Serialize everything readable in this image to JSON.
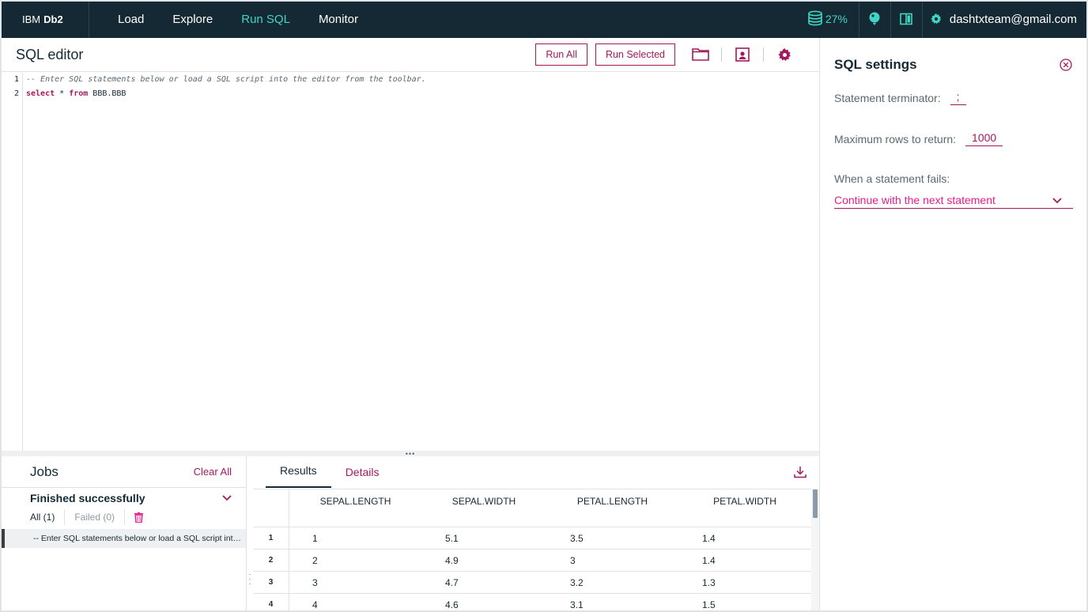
{
  "nav": {
    "brand_prefix": "IBM",
    "brand_bold": "Db2",
    "items": [
      {
        "label": "Load",
        "active": false
      },
      {
        "label": "Explore",
        "active": false
      },
      {
        "label": "Run SQL",
        "active": true
      },
      {
        "label": "Monitor",
        "active": false
      }
    ],
    "usage": "27%",
    "user": "dashtxteam@gmail.com",
    "icons": [
      "database-icon",
      "help-balloon-icon",
      "book-icon",
      "gear-icon"
    ]
  },
  "editor": {
    "title": "SQL editor",
    "run_all": "Run All",
    "run_selected": "Run Selected",
    "line_numbers": [
      "1",
      "2"
    ],
    "line1_comment": "-- Enter SQL statements below or load a SQL script into the editor from the toolbar.",
    "line2_kw1": "select",
    "line2_star": " * ",
    "line2_kw2": "from",
    "line2_table": " BBB.BBB",
    "tool_icons": [
      "folder-icon",
      "save-script-icon",
      "gear-icon"
    ]
  },
  "splitter": "•••",
  "jobs": {
    "title": "Jobs",
    "clear_all": "Clear All",
    "status": "Finished successfully",
    "filter_all": "All (1)",
    "filter_failed": "Failed (0)",
    "item": "-- Enter SQL statements below or load a SQL script into the editor from the toolbar."
  },
  "results": {
    "tab_results": "Results",
    "tab_details": "Details",
    "columns": [
      "SEPAL.LENGTH",
      "SEPAL.WIDTH",
      "PETAL.LENGTH",
      "PETAL.WIDTH"
    ],
    "rows": [
      {
        "idx": "1",
        "cells": [
          "1",
          "5.1",
          "3.5",
          "1.4"
        ]
      },
      {
        "idx": "2",
        "cells": [
          "2",
          "4.9",
          "3",
          "1.4"
        ]
      },
      {
        "idx": "3",
        "cells": [
          "3",
          "4.7",
          "3.2",
          "1.3"
        ]
      },
      {
        "idx": "4",
        "cells": [
          "4",
          "4.6",
          "3.1",
          "1.5"
        ]
      }
    ]
  },
  "settings": {
    "title": "SQL settings",
    "terminator_label": "Statement terminator:",
    "terminator_value": ";",
    "max_rows_label": "Maximum rows to return:",
    "max_rows_value": "1000",
    "fail_label": "When a statement fails:",
    "fail_value": "Continue with the next statement"
  },
  "colors": {
    "accent": "#a3195b",
    "nav_bg": "#152935",
    "active_nav": "#41d6c3",
    "select_text": "#e71d8c"
  }
}
